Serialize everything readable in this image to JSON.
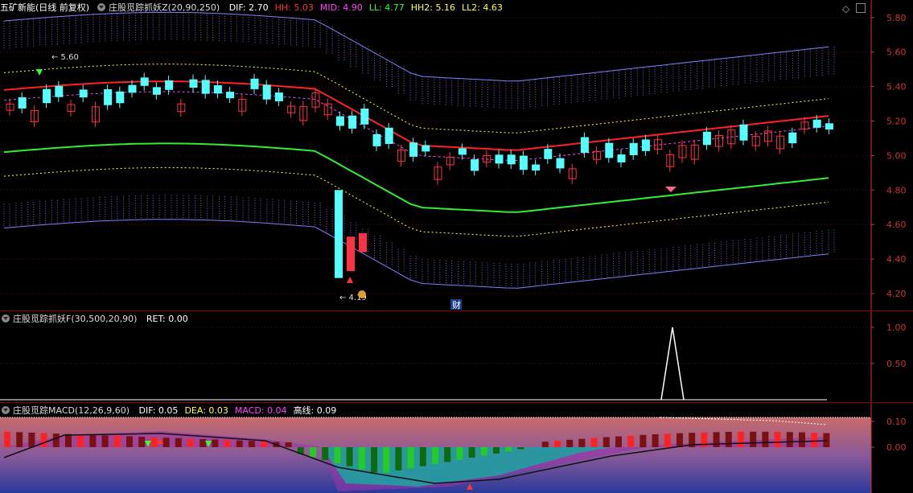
{
  "stock": {
    "name": "五矿新能",
    "period": "(日线 前复权)"
  },
  "main_panel": {
    "indicator": "庄股觅踪抓妖Z(20,90,250)",
    "fields": [
      {
        "label": "DIF: 2.70",
        "color": "#ffffff"
      },
      {
        "label": "HH: 5.03",
        "color": "#ff3333"
      },
      {
        "label": "MID: 4.90",
        "color": "#ff44ff"
      },
      {
        "label": "LL: 4.77",
        "color": "#33ff33"
      },
      {
        "label": "HH2: 5.16",
        "color": "#ffff55"
      },
      {
        "label": "LL2: 4.63",
        "color": "#ffff55"
      }
    ],
    "y_ticks": [
      "5.80",
      "5.60",
      "5.40",
      "5.20",
      "5.00",
      "4.80",
      "4.60",
      "4.40",
      "4.20"
    ],
    "high_marker": "5.60",
    "low_marker": "4.19",
    "finance_badge": "财"
  },
  "sub_panel_1": {
    "indicator": "庄股觅踪抓妖F(30,500,20,90)",
    "fields": [
      {
        "label": "RET: 0.00",
        "color": "#ffffff"
      }
    ],
    "y_ticks": [
      "1.00",
      "0.50"
    ]
  },
  "sub_panel_2": {
    "indicator": "庄股觅踪MACD(12,26,9,60)",
    "fields": [
      {
        "label": "DIF: 0.05",
        "color": "#ffffff"
      },
      {
        "label": "DEA: 0.03",
        "color": "#ffff55"
      },
      {
        "label": "MACD: 0.04",
        "color": "#ff44ff"
      },
      {
        "label": "高线: 0.09",
        "color": "#ffffff"
      }
    ],
    "y_ticks": [
      "0.10",
      "0.00"
    ]
  },
  "colors": {
    "up": "#ff3344",
    "down": "#55ffff",
    "grid": "#8b0000",
    "axis": "#cc3333"
  },
  "icons": [
    "indicator-menu-icon",
    "diamond-icon",
    "panel-toggle-icon"
  ]
}
